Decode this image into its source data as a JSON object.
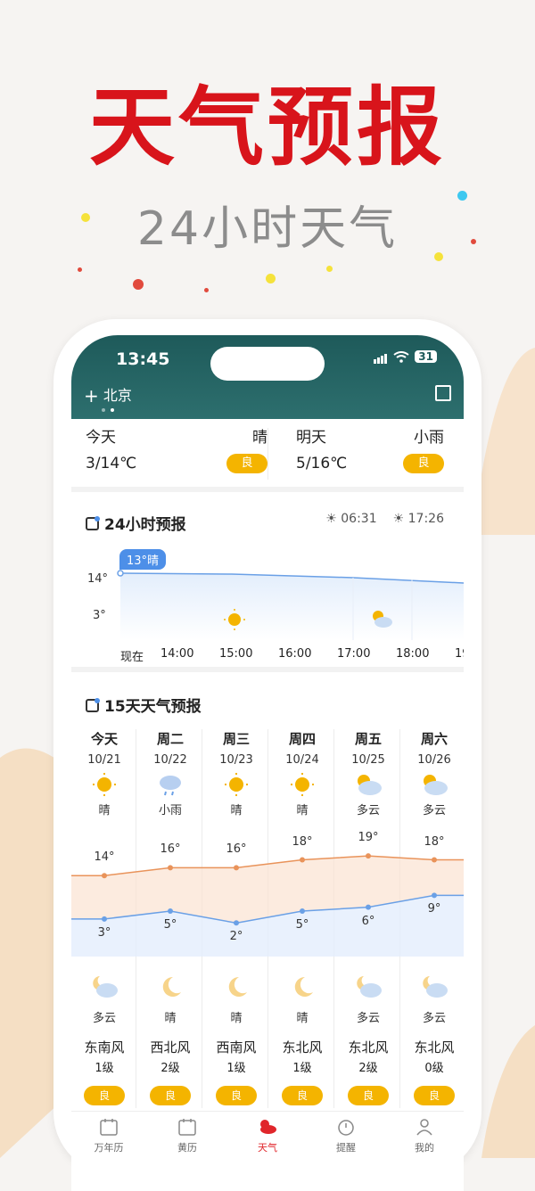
{
  "promo": {
    "headline": "天气预报",
    "subtitle": "24小时天气"
  },
  "status_bar": {
    "time": "13:45",
    "battery": "31"
  },
  "header": {
    "city": "北京"
  },
  "today_tomorrow": [
    {
      "day": "今天",
      "weather": "晴",
      "range": "3/14℃",
      "aqi": "良"
    },
    {
      "day": "明天",
      "weather": "小雨",
      "range": "5/16℃",
      "aqi": "良"
    }
  ],
  "hourly": {
    "title": "24小时预报",
    "sunrise": "06:31",
    "sunset": "17:26",
    "current_tag": "13°晴",
    "y_high": "14°",
    "y_low": "3°",
    "labels": [
      "现在",
      "14:00",
      "15:00",
      "16:00",
      "17:00",
      "18:00",
      "19"
    ]
  },
  "daily": {
    "title": "15天天气预报",
    "days": [
      {
        "name": "今天",
        "date": "10/21",
        "day_weather": "晴",
        "day_icon": "sun-icon",
        "high": "14°",
        "low": "3°",
        "night_weather": "多云",
        "night_icon": "cloudy-night-icon",
        "wind": "东南风",
        "level": "1级",
        "aqi": "良"
      },
      {
        "name": "周二",
        "date": "10/22",
        "day_weather": "小雨",
        "day_icon": "rain-icon",
        "high": "16°",
        "low": "5°",
        "night_weather": "晴",
        "night_icon": "moon-icon",
        "wind": "西北风",
        "level": "2级",
        "aqi": "良"
      },
      {
        "name": "周三",
        "date": "10/23",
        "day_weather": "晴",
        "day_icon": "sun-icon",
        "high": "16°",
        "low": "2°",
        "night_weather": "晴",
        "night_icon": "moon-icon",
        "wind": "西南风",
        "level": "1级",
        "aqi": "良"
      },
      {
        "name": "周四",
        "date": "10/24",
        "day_weather": "晴",
        "day_icon": "sun-icon",
        "high": "18°",
        "low": "5°",
        "night_weather": "晴",
        "night_icon": "moon-icon",
        "wind": "东北风",
        "level": "1级",
        "aqi": "良"
      },
      {
        "name": "周五",
        "date": "10/25",
        "day_weather": "多云",
        "day_icon": "partly-cloudy-icon",
        "high": "19°",
        "low": "6°",
        "night_weather": "多云",
        "night_icon": "cloudy-night-icon",
        "wind": "东北风",
        "level": "2级",
        "aqi": "良"
      },
      {
        "name": "周六",
        "date": "10/26",
        "day_weather": "多云",
        "day_icon": "partly-cloudy-icon",
        "high": "18°",
        "low": "9°",
        "night_weather": "多云",
        "night_icon": "cloudy-night-icon",
        "wind": "东北风",
        "level": "0级",
        "aqi": "良"
      }
    ]
  },
  "nav": [
    {
      "label": "万年历",
      "icon": "calendar-icon"
    },
    {
      "label": "黄历",
      "icon": "almanac-icon"
    },
    {
      "label": "天气",
      "icon": "weather-icon"
    },
    {
      "label": "提醒",
      "icon": "alarm-clock-icon"
    },
    {
      "label": "我的",
      "icon": "person-icon"
    }
  ],
  "colors": {
    "headline": "#d8141b",
    "header_bg": "#1e5a5a",
    "aqi_badge": "#f4b400",
    "high_line": "#e9935a",
    "low_line": "#6aa0e6",
    "active_tab": "#e0262b"
  }
}
